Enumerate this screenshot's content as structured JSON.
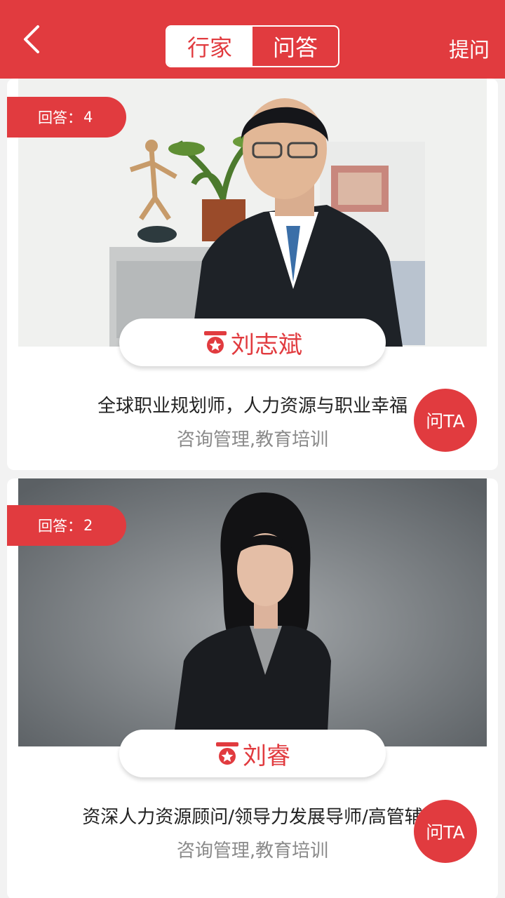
{
  "header": {
    "tabs": [
      {
        "label": "行家"
      },
      {
        "label": "问答"
      }
    ],
    "ask_label": "提问"
  },
  "experts": [
    {
      "answers_label": "回答：",
      "answers_count": "4",
      "name": "刘志斌",
      "bio": "全球职业规划师，人力资源与职业幸福",
      "tags": "咨询管理,教育培训",
      "ask_label": "问TA"
    },
    {
      "answers_label": "回答：",
      "answers_count": "2",
      "name": "刘睿",
      "bio": "资深人力资源顾问/领导力发展导师/高管辅",
      "tags": "咨询管理,教育培训",
      "ask_label": "问TA"
    }
  ],
  "colors": {
    "brand": "#e13b3f",
    "card_bg": "#ffffff",
    "page_bg": "#f2f2f2"
  }
}
